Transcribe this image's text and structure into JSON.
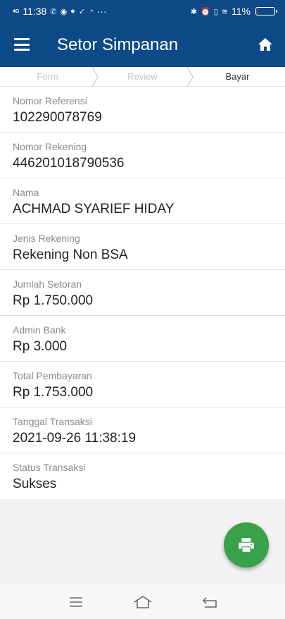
{
  "status_bar": {
    "time": "11:38",
    "network": "4G",
    "notification_icons": [
      "whatsapp-icon",
      "messenger-icon",
      "chat-icon",
      "check-circle-icon",
      "clock-icon"
    ],
    "overflow": "···",
    "battery_percent": "11%",
    "battery_level": 0.11,
    "battery_color": "#ff3b30"
  },
  "app_bar": {
    "title": "Setor Simpanan",
    "menu_icon": "hamburger-icon",
    "home_icon": "home-icon",
    "background": "#0d4a87"
  },
  "stepper": {
    "steps": [
      {
        "label": "Form",
        "active": false
      },
      {
        "label": "Review",
        "active": false
      },
      {
        "label": "Bayar",
        "active": true
      }
    ]
  },
  "details": [
    {
      "label": "Nomor Referensi",
      "value": "102290078769"
    },
    {
      "label": "Nomor Rekening",
      "value": "446201018790536"
    },
    {
      "label": "Nama",
      "value": "ACHMAD SYARIEF HIDAY"
    },
    {
      "label": "Jenis Rekening",
      "value": "Rekening Non BSA"
    },
    {
      "label": "Jumlah Setoran",
      "value": "Rp 1.750.000"
    },
    {
      "label": "Admin Bank",
      "value": "Rp 3.000"
    },
    {
      "label": "Total Pembayaran",
      "value": "Rp 1.753.000"
    },
    {
      "label": "Tanggal Transaksi",
      "value": "2021-09-26 11:38:19"
    },
    {
      "label": "Status Transaksi",
      "value": "Sukses"
    }
  ],
  "fab": {
    "icon": "print-icon",
    "color": "#3aa14a"
  },
  "nav_bar": {
    "icons": [
      "menu-nav-icon",
      "home-nav-icon",
      "back-nav-icon"
    ]
  }
}
